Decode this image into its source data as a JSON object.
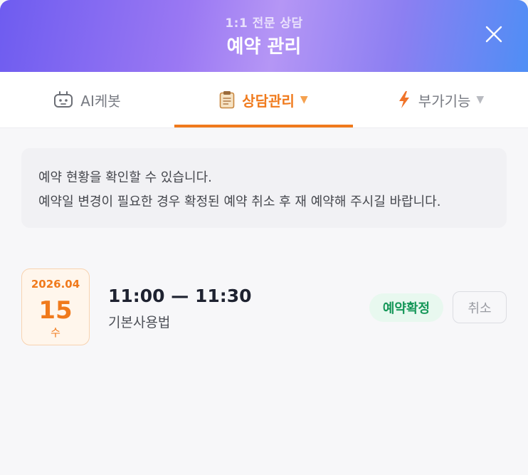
{
  "header": {
    "subtitle": "1:1 전문 상담",
    "title": "예약 관리",
    "close_icon": "close-icon"
  },
  "tabs": [
    {
      "label": "AI케봇",
      "icon": "robot-icon",
      "active": false,
      "has_dropdown": false
    },
    {
      "label": "상담관리",
      "icon": "clipboard-icon",
      "active": true,
      "has_dropdown": true
    },
    {
      "label": "부가기능",
      "icon": "lightning-icon",
      "active": false,
      "has_dropdown": true
    }
  ],
  "notice": {
    "line1": "예약 현황을 확인할 수 있습니다.",
    "line2": "예약일 변경이 필요한 경우 확정된 예약 취소 후 재 예약해 주시길 바랍니다."
  },
  "reservation": {
    "year_month": "2026.04",
    "day": "15",
    "weekday": "수",
    "time": "11:00 — 11:30",
    "service": "기본사용법",
    "status": "예약확정",
    "cancel_label": "취소"
  },
  "colors": {
    "accent": "#f07a1c",
    "status_green": "#17985a",
    "header_gradient_start": "#6e5cf0",
    "header_gradient_end": "#4f8ef5"
  }
}
